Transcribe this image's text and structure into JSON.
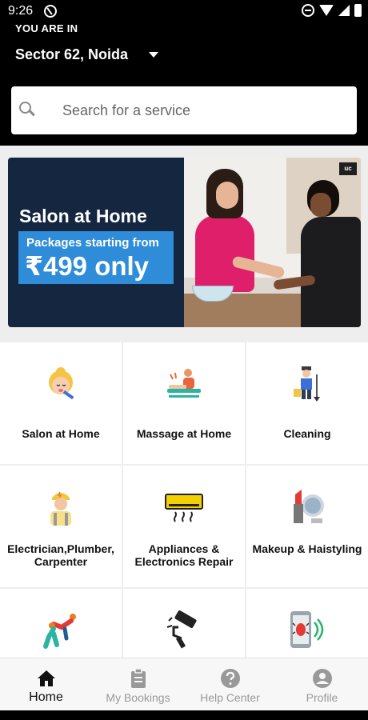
{
  "status_bar": {
    "time": "9:26",
    "icons": [
      "at-sign-icon",
      "dnd-icon",
      "wifi-icon",
      "signal-icon",
      "battery-icon"
    ]
  },
  "header": {
    "you_are_in_label": "YOU ARE IN",
    "location": "Sector 62, Noida",
    "search_placeholder": "Search for a service"
  },
  "banner": {
    "title": "Salon at Home",
    "subtitle": "Packages starting from",
    "price": "₹499 only",
    "badge": "uc",
    "colors": {
      "left_bg": "#142640",
      "box_bg": "#2f8cd8"
    }
  },
  "services": [
    {
      "label": "Salon at Home",
      "icon": "salon-icon"
    },
    {
      "label": "Massage at Home",
      "icon": "massage-icon"
    },
    {
      "label": "Cleaning",
      "icon": "cleaning-icon"
    },
    {
      "label": "Electrician,Plumber, Carpenter",
      "icon": "electrician-icon"
    },
    {
      "label": "Appliances & Electronics Repair",
      "icon": "air-conditioner-icon"
    },
    {
      "label": "Makeup & Haistyling",
      "icon": "makeup-icon"
    },
    {
      "label": "",
      "icon": "fitness-icon"
    },
    {
      "label": "",
      "icon": "paint-roller-icon"
    },
    {
      "label": "",
      "icon": "pest-control-icon"
    }
  ],
  "bottom_nav": [
    {
      "label": "Home",
      "icon": "home-icon",
      "active": true
    },
    {
      "label": "My Bookings",
      "icon": "clipboard-icon",
      "active": false
    },
    {
      "label": "Help Center",
      "icon": "help-icon",
      "active": false
    },
    {
      "label": "Profile",
      "icon": "profile-icon",
      "active": false
    }
  ]
}
